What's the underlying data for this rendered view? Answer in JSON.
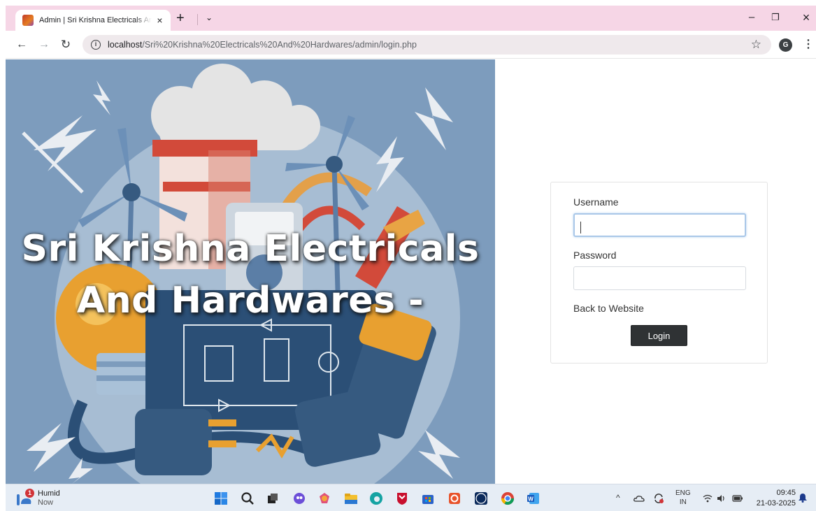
{
  "browser": {
    "tab_title": "Admin | Sri Krishna Electricals And Hardwares",
    "tab_close": "×",
    "new_tab": "+",
    "tab_search": "⌄",
    "window_minimize": "–",
    "window_restore": "❐",
    "window_close": "×",
    "back": "←",
    "forward": "→",
    "reload": "↻",
    "url_host": "localhost",
    "url_path": "/Sri%20Krishna%20Electricals%20And%20Hardwares/admin/login.php",
    "bookmark_star": "☆",
    "profile_initial": "G",
    "menu": "⋮"
  },
  "hero": {
    "line1": "Sri Krishna Electricals",
    "line2": "And Hardwares -",
    "background_color": "#7d9cbd"
  },
  "login": {
    "username_label": "Username",
    "username_value": "",
    "password_label": "Password",
    "password_value": "",
    "back_link": "Back to Website",
    "submit_label": "Login"
  },
  "taskbar": {
    "weather_badge": "1",
    "weather_condition": "Humid",
    "weather_time": "Now",
    "tray_chevron": "^",
    "lang_line1": "ENG",
    "lang_line2": "IN",
    "clock_time": "09:45",
    "clock_date": "21-03-2025",
    "apps": [
      "windows-start",
      "search",
      "task-view",
      "copilot",
      "widgets",
      "file-explorer",
      "edge",
      "mcafee",
      "store",
      "office",
      "dell",
      "chrome",
      "word"
    ]
  },
  "colors": {
    "tabstrip": "#f6d6e6",
    "login_button": "#2f3234",
    "taskbar": "#e6edf5"
  }
}
